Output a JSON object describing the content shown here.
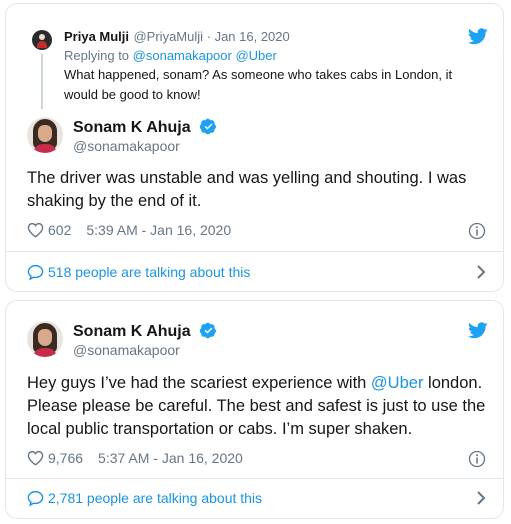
{
  "tweet1": {
    "reply": {
      "name": "Priya Mulji",
      "handle_date": "@PriyaMulji · Jan 16, 2020",
      "replying_prefix": "Replying to ",
      "replying_handles": "@sonamakapoor @Uber",
      "text_line1": "What happened, sonam? As someone who takes cabs in London, it",
      "text_line2": "would be good to know!"
    },
    "author": {
      "name": "Sonam K Ahuja",
      "handle": "@sonamakapoor"
    },
    "body_line1": "The driver was unstable and was yelling and shouting. I was",
    "body_line2": "shaking by the end of it.",
    "likes": "602",
    "timestamp": "5:39 AM - Jan 16, 2020",
    "talking": "518 people are talking about this"
  },
  "tweet2": {
    "author": {
      "name": "Sonam K Ahuja",
      "handle": "@sonamakapoor"
    },
    "body_line1_a": "Hey guys I’ve had the scariest experience with ",
    "body_mention": "@Uber",
    "body_line1_b": " london.",
    "body_line2": "Please please be careful. The best and safest is just to use the",
    "body_line3": "local public transportation or cabs. I’m super shaken.",
    "likes": "9,766",
    "timestamp": "5:37 AM - Jan 16, 2020",
    "talking": "2,781 people are talking about this"
  },
  "colors": {
    "brand": "#1da1f2",
    "link": "#1b95e0",
    "muted": "#657786",
    "border": "#e1e8ed"
  },
  "icons": [
    "twitter-bird-icon",
    "verified-badge-icon",
    "heart-icon",
    "info-icon",
    "speech-bubble-icon",
    "chevron-right-icon"
  ]
}
